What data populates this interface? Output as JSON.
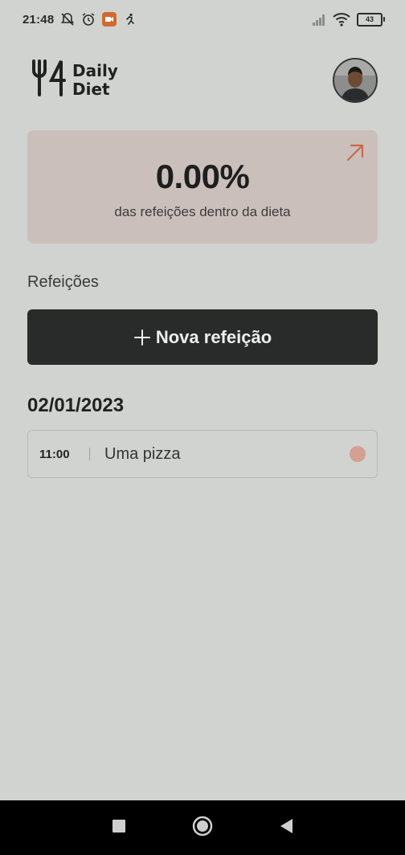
{
  "status_bar": {
    "time": "21:48",
    "icons": [
      "notifications-off-icon",
      "alarm-icon",
      "video-app-icon",
      "run-icon"
    ],
    "right_icons": [
      "signal-icon",
      "wifi-icon",
      "battery-icon"
    ],
    "battery": "43"
  },
  "header": {
    "logo_line1": "Daily",
    "logo_line2": "Diet",
    "logo_icon": "fork-knife-icon",
    "avatar": "user-avatar"
  },
  "stats": {
    "percent": "0.00%",
    "caption": "das refeições dentro da dieta",
    "accent_color": "#c9694a",
    "background_color": "#cbbfbc"
  },
  "meals": {
    "section_title": "Refeições",
    "new_meal_label": "Nova refeição",
    "groups": [
      {
        "date": "02/01/2023",
        "items": [
          {
            "time": "11:00",
            "name": "Uma pizza",
            "status_color": "#d4a092"
          }
        ]
      }
    ]
  },
  "nav": {
    "buttons": [
      "recents-button",
      "home-button",
      "back-button"
    ]
  }
}
